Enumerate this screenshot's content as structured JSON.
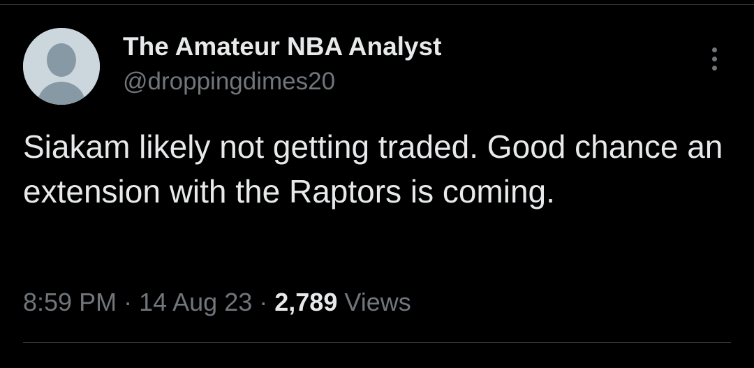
{
  "tweet": {
    "author": {
      "display_name": "The Amateur NBA Analyst",
      "handle": "@droppingdimes20"
    },
    "text": "Siakam likely not getting traded. Good chance an extension with the Raptors is coming.",
    "time": "8:59 PM",
    "date": "14 Aug 23",
    "separator": "·",
    "views_count": "2,789",
    "views_label": "Views"
  },
  "icons": {
    "avatar": "default-avatar-icon",
    "more": "more-options-icon"
  },
  "colors": {
    "background": "#000000",
    "primary_text": "#e7e9ea",
    "secondary_text": "#71767b",
    "divider": "#2f3336",
    "avatar_bg": "#ccd6dd",
    "avatar_figure": "#8899a6"
  }
}
